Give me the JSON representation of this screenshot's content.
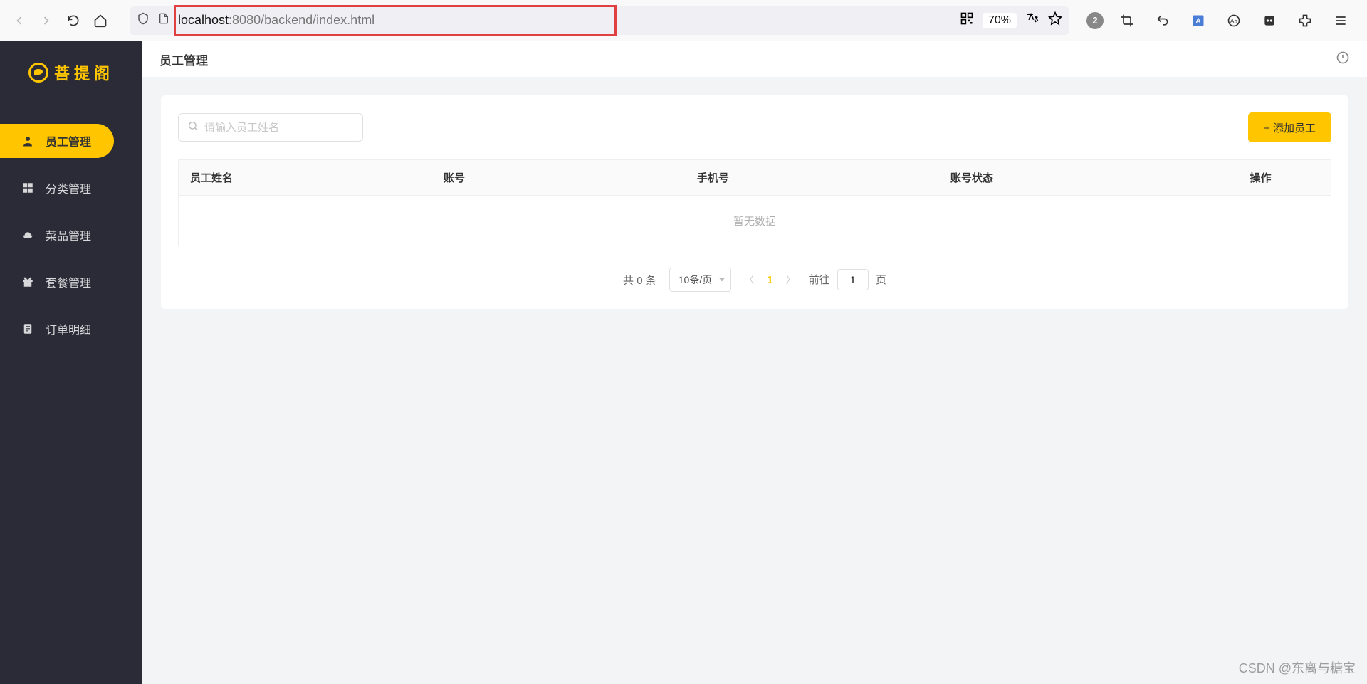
{
  "browser": {
    "url_host": "localhost",
    "url_path": ":8080/backend/index.html",
    "zoom": "70%",
    "badge_count": "2"
  },
  "sidebar": {
    "brand": "菩提阁",
    "items": [
      {
        "label": "员工管理",
        "icon": "user"
      },
      {
        "label": "分类管理",
        "icon": "grid"
      },
      {
        "label": "菜品管理",
        "icon": "dish"
      },
      {
        "label": "套餐管理",
        "icon": "gift"
      },
      {
        "label": "订单明细",
        "icon": "doc"
      }
    ]
  },
  "header": {
    "title": "员工管理"
  },
  "search": {
    "placeholder": "请输入员工姓名"
  },
  "toolbar": {
    "add_label": "+ 添加员工"
  },
  "table": {
    "columns": {
      "name": "员工姓名",
      "account": "账号",
      "phone": "手机号",
      "status": "账号状态",
      "action": "操作"
    },
    "empty_text": "暂无数据"
  },
  "pagination": {
    "total_text_prefix": "共",
    "total_count": "0",
    "total_text_suffix": "条",
    "page_size_label": "10条/页",
    "current_page": "1",
    "jump_prefix": "前往",
    "jump_value": "1",
    "jump_suffix": "页"
  },
  "watermark": "CSDN @东离与糖宝"
}
